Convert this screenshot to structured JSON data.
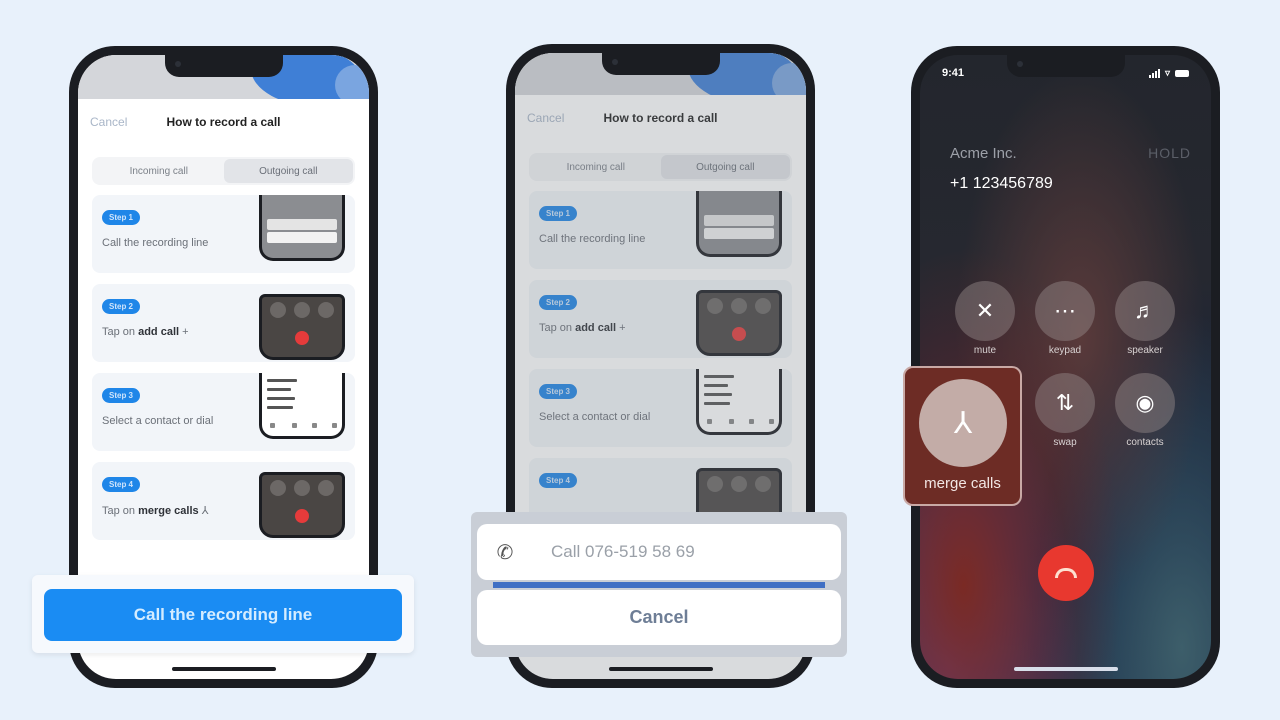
{
  "guide": {
    "cancel_label": "Cancel",
    "title": "How to record a call",
    "tabs": [
      {
        "label": "Incoming call",
        "active": false
      },
      {
        "label": "Outgoing call",
        "active": true
      }
    ],
    "steps": [
      {
        "badge": "Step 1",
        "text": "Call the recording line",
        "bold": "",
        "suffix_icon": ""
      },
      {
        "badge": "Step 2",
        "text": "Tap on ",
        "bold": "add call",
        "suffix_icon": "+"
      },
      {
        "badge": "Step 3",
        "text": "Select a contact or dial",
        "bold": "",
        "suffix_icon": ""
      },
      {
        "badge": "Step 4",
        "text": "Tap on ",
        "bold": "merge calls",
        "suffix_icon": "⅄"
      }
    ]
  },
  "primary_button": {
    "label": "Call the recording line"
  },
  "call_sheet": {
    "call_label": "Call 076-519 58 69",
    "cancel_label": "Cancel",
    "progress": 1.0
  },
  "call_screen": {
    "time": "9:41",
    "caller_name": "Acme Inc.",
    "hold_label": "HOLD",
    "caller_number": "+1 123456789",
    "buttons": [
      {
        "label": "mute",
        "icon": "mic-off-icon",
        "glyph": "🎙"
      },
      {
        "label": "keypad",
        "icon": "keypad-icon",
        "glyph": "⠿"
      },
      {
        "label": "speaker",
        "icon": "speaker-icon",
        "glyph": "🔊"
      },
      {
        "label": "merge calls",
        "icon": "merge-icon",
        "glyph": "⅄"
      },
      {
        "label": "swap",
        "icon": "swap-icon",
        "glyph": "⇅"
      },
      {
        "label": "contacts",
        "icon": "contact-icon",
        "glyph": "◉"
      }
    ]
  },
  "colors": {
    "accent": "#1a8cf3",
    "end_call": "#e8382f",
    "background": "#e8f1fb"
  }
}
